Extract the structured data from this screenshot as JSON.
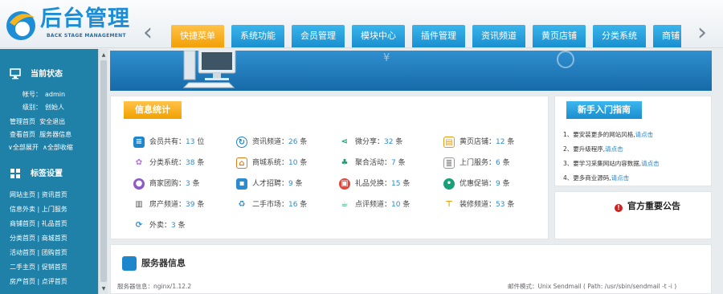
{
  "logo": {
    "title": "后台管理",
    "subtitle": "BACK STAGE MANAGEMENT"
  },
  "nav": {
    "prev_icon": "chevron-left-icon",
    "next_icon": "chevron-right-icon",
    "tabs": [
      {
        "label": "快捷菜单",
        "active": true
      },
      {
        "label": "系统功能"
      },
      {
        "label": "会员管理"
      },
      {
        "label": "模块中心"
      },
      {
        "label": "插件管理"
      },
      {
        "label": "资讯频道"
      },
      {
        "label": "黄页店铺"
      },
      {
        "label": "分类系统"
      },
      {
        "label": "商铺"
      }
    ],
    "accent_active": "#f5a80c",
    "accent_tab": "#2aa2e0"
  },
  "sidebar": {
    "status_title": "当前状态",
    "account_label": "帐号：",
    "account_value": "admin",
    "level_label": "级别：",
    "level_value": "创始人",
    "links1": [
      "管理首页",
      "安全退出"
    ],
    "links2": [
      "查看首页",
      "服务器信息"
    ],
    "links3": [
      "全部展开",
      "全部收缩"
    ],
    "tags_title": "标签设置",
    "tag_rows": [
      [
        "网站主页",
        "资讯首页"
      ],
      [
        "信息外卖",
        "上门服务"
      ],
      [
        "商铺首页",
        "礼品首页"
      ],
      [
        "分类首页",
        "商城首页"
      ],
      [
        "活动首页",
        "团购首页"
      ],
      [
        "二手主页",
        "促销首页"
      ],
      [
        "房产首页",
        "点评首页"
      ]
    ],
    "separator": "|",
    "bg": "#1f80a8"
  },
  "stats": {
    "title": "信息统计",
    "unit_sep": "：",
    "items": [
      {
        "label": "会员共有",
        "value": "13",
        "unit": "位",
        "icon": "toggle-icon"
      },
      {
        "label": "资讯频道",
        "value": "26",
        "unit": "条",
        "icon": "sync-icon"
      },
      {
        "label": "微分享",
        "value": "32",
        "unit": "条",
        "icon": "share-icon"
      },
      {
        "label": "黄页店铺",
        "value": "12",
        "unit": "条",
        "icon": "book-icon"
      },
      {
        "label": "分类系统",
        "value": "38",
        "unit": "条",
        "icon": "flower-icon"
      },
      {
        "label": "商城系统",
        "value": "10",
        "unit": "条",
        "icon": "store-icon"
      },
      {
        "label": "聚合活动",
        "value": "7",
        "unit": "条",
        "icon": "people-icon"
      },
      {
        "label": "上门服务",
        "value": "6",
        "unit": "条",
        "icon": "list-icon"
      },
      {
        "label": "商家团购",
        "value": "3",
        "unit": "条",
        "icon": "group-icon"
      },
      {
        "label": "人才招聘",
        "value": "9",
        "unit": "条",
        "icon": "person-icon"
      },
      {
        "label": "礼品兑换",
        "value": "15",
        "unit": "条",
        "icon": "gift-icon"
      },
      {
        "label": "优惠促销",
        "value": "9",
        "unit": "条",
        "icon": "coupon-icon"
      },
      {
        "label": "房产频道",
        "value": "39",
        "unit": "条",
        "icon": "building-icon"
      },
      {
        "label": "二手市场",
        "value": "16",
        "unit": "条",
        "icon": "recycle-icon"
      },
      {
        "label": "点评频道",
        "value": "10",
        "unit": "条",
        "icon": "cup-icon"
      },
      {
        "label": "装修频道",
        "value": "53",
        "unit": "条",
        "icon": "paint-roller-icon"
      },
      {
        "label": "外卖",
        "value": "3",
        "unit": "条",
        "icon": "refresh-icon"
      }
    ]
  },
  "guide": {
    "title": "新手入门指南",
    "items": [
      {
        "num": "1、",
        "text": "要安装更多的网站风格,",
        "link": "请点击"
      },
      {
        "num": "2、",
        "text": "要升级程序,",
        "link": "请点击"
      },
      {
        "num": "3、",
        "text": "要学习采集网站内容数据,",
        "link": "请点击"
      },
      {
        "num": "4、",
        "text": "更多商业源码,",
        "link": "请点击"
      }
    ]
  },
  "notice": {
    "title": "官方重要公告",
    "icon": "alert-icon"
  },
  "server": {
    "title": "服务器信息",
    "software": "服务器信息：nginx/1.12.2",
    "mail": "邮件模式：Unix Sendmail ( Path: /usr/sbin/sendmail -t -i )"
  }
}
